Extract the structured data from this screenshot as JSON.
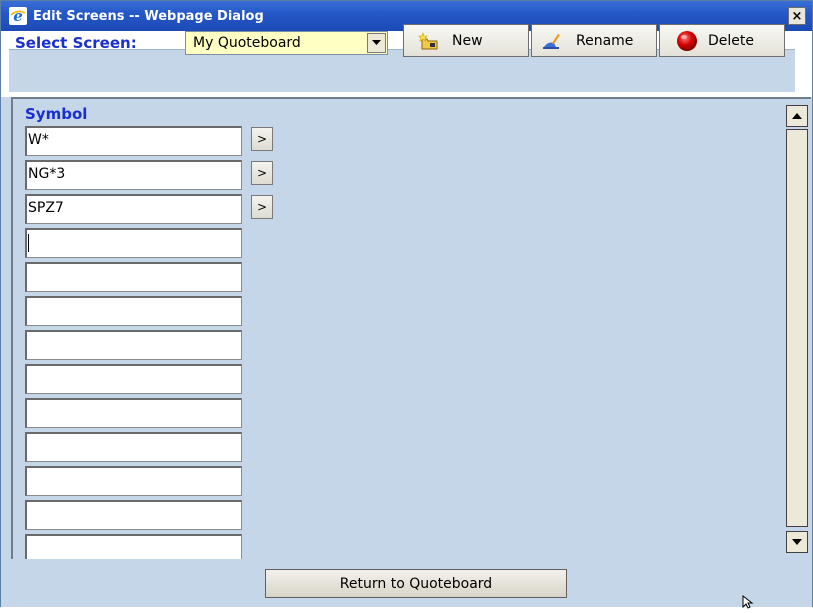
{
  "window": {
    "title": "Edit Screens -- Webpage Dialog",
    "close_label": "×"
  },
  "toolbar": {
    "select_label": "Select Screen:",
    "selected_screen": "My Quoteboard",
    "new_label": "New",
    "rename_label": "Rename",
    "delete_label": "Delete"
  },
  "symbols": {
    "header": "Symbol",
    "go_label": ">",
    "rows": [
      "W*",
      "NG*3",
      "SPZ7",
      "",
      "",
      "",
      "",
      "",
      "",
      "",
      "",
      "",
      ""
    ]
  },
  "footer": {
    "return_label": "Return to Quoteboard"
  },
  "colors": {
    "title_bar": "#2558c8",
    "label_blue": "#1a2fcf",
    "panel_bg": "#c5d6e8",
    "select_bg": "#ffffc4",
    "delete_icon": "#d40000"
  }
}
